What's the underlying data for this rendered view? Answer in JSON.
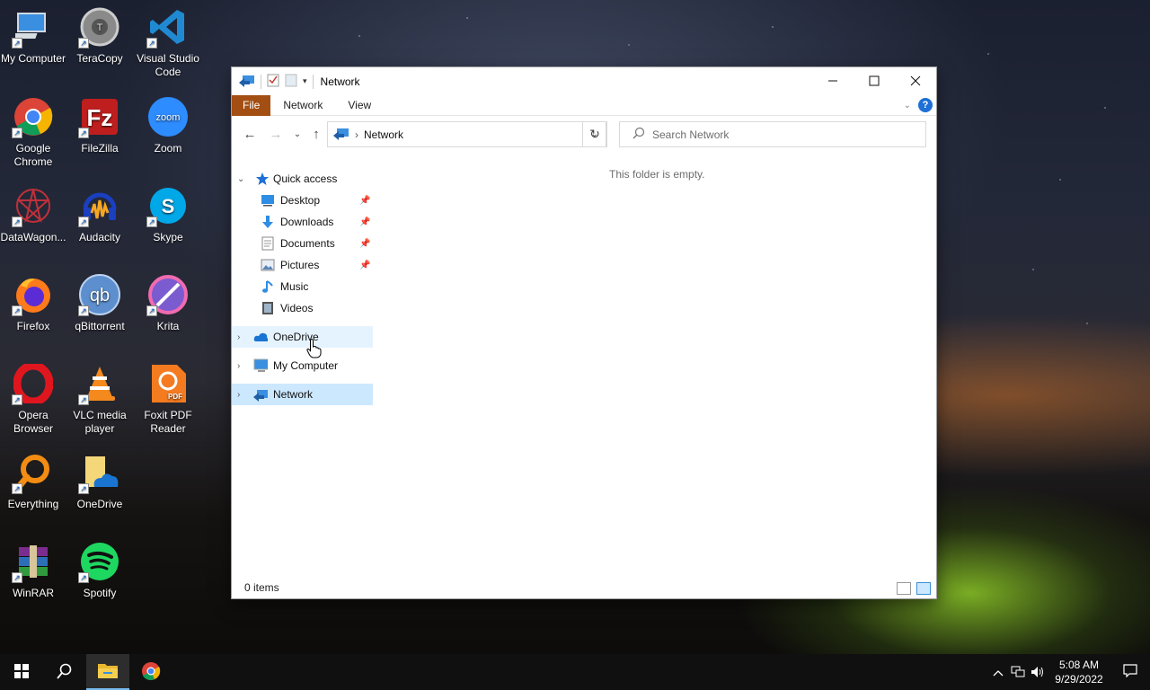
{
  "desktop": {
    "icons": [
      {
        "label": "My Computer",
        "icon": "computer-icon"
      },
      {
        "label": "TeraCopy",
        "icon": "teracopy-icon"
      },
      {
        "label": "Visual Studio Code",
        "icon": "vscode-icon"
      },
      {
        "label": "Google Chrome",
        "icon": "chrome-icon"
      },
      {
        "label": "FileZilla",
        "icon": "filezilla-icon"
      },
      {
        "label": "Zoom",
        "icon": "zoom-icon"
      },
      {
        "label": "DataWagon...",
        "icon": "datawagon-icon"
      },
      {
        "label": "Audacity",
        "icon": "audacity-icon"
      },
      {
        "label": "Skype",
        "icon": "skype-icon"
      },
      {
        "label": "Firefox",
        "icon": "firefox-icon"
      },
      {
        "label": "qBittorrent",
        "icon": "qbittorrent-icon"
      },
      {
        "label": "Krita",
        "icon": "krita-icon"
      },
      {
        "label": "Opera Browser",
        "icon": "opera-icon"
      },
      {
        "label": "VLC media player",
        "icon": "vlc-icon"
      },
      {
        "label": "Foxit PDF Reader",
        "icon": "foxit-icon"
      },
      {
        "label": "Everything",
        "icon": "everything-icon"
      },
      {
        "label": "OneDrive",
        "icon": "onedrive-icon"
      },
      {
        "label": "WinRAR",
        "icon": "winrar-icon"
      },
      {
        "label": "Spotify",
        "icon": "spotify-icon"
      }
    ],
    "shortcut_glyph": "↗"
  },
  "window": {
    "title": "Network",
    "ribbon_tabs": [
      "File",
      "Network",
      "View"
    ],
    "help_label": "?",
    "address": {
      "path": "Network",
      "separator": "›"
    },
    "search_placeholder": "Search Network",
    "nav": {
      "quick_access": "Quick access",
      "items": [
        "Desktop",
        "Downloads",
        "Documents",
        "Pictures",
        "Music",
        "Videos"
      ],
      "onedrive": "OneDrive",
      "my_computer": "My Computer",
      "network": "Network"
    },
    "empty_message": "This folder is empty.",
    "status": "0 items"
  },
  "taskbar": {
    "time": "5:08 AM",
    "date": "9/29/2022"
  },
  "colors": {
    "file_tab": "#a34e12",
    "selection": "#cce8ff",
    "hover": "#e5f3ff",
    "accent": "#1e6fd6"
  }
}
